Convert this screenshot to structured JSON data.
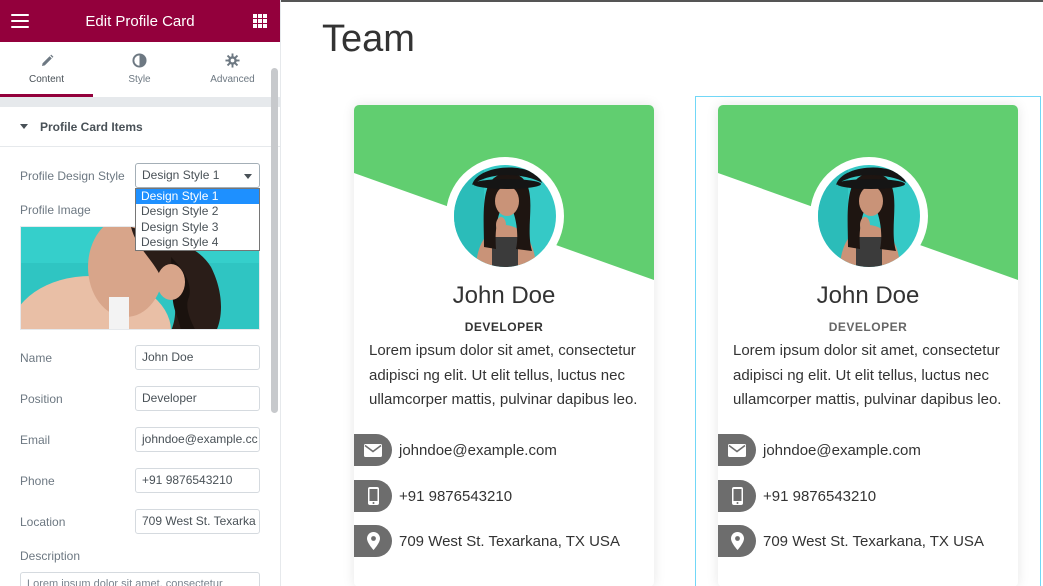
{
  "sidebar": {
    "title": "Edit Profile Card",
    "tabs": [
      {
        "label": "Content",
        "icon": "pencil-icon",
        "active": true
      },
      {
        "label": "Style",
        "icon": "half-circle-icon",
        "active": false
      },
      {
        "label": "Advanced",
        "icon": "gear-icon",
        "active": false
      }
    ],
    "section_title": "Profile Card Items",
    "design_style": {
      "label": "Profile Design Style",
      "value": "Design Style 1",
      "options": [
        "Design Style 1",
        "Design Style 2",
        "Design Style 3",
        "Design Style 4"
      ]
    },
    "profile_image_label": "Profile Image",
    "fields": {
      "name": {
        "label": "Name",
        "value": "John Doe"
      },
      "position": {
        "label": "Position",
        "value": "Developer"
      },
      "email": {
        "label": "Email",
        "value": "johndoe@example.cc"
      },
      "phone": {
        "label": "Phone",
        "value": "+91 9876543210"
      },
      "location": {
        "label": "Location",
        "value": "709 West St. Texarka"
      },
      "description": {
        "label": "Description",
        "value": "Lorem ipsum dolor sit amet, consectetur"
      }
    }
  },
  "page": {
    "title": "Team"
  },
  "cards": [
    {
      "name": "John Doe",
      "position": "DEVELOPER",
      "description": "Lorem ipsum dolor sit amet, consectetur adipisci ng elit. Ut elit tellus, luctus nec ullamcorper mattis, pulvinar dapibus leo.",
      "email": "johndoe@example.com",
      "phone": "+91 9876543210",
      "location": "709 West St. Texarkana, TX USA"
    },
    {
      "name": "John Doe",
      "position": "DEVELOPER",
      "description": "Lorem ipsum dolor sit amet, consectetur adipisci ng elit. Ut elit tellus, luctus nec ullamcorper mattis, pulvinar dapibus leo.",
      "email": "johndoe@example.com",
      "phone": "+91 9876543210",
      "location": "709 West St. Texarkana, TX USA"
    }
  ],
  "colors": {
    "brand": "#93003c",
    "card_accent": "#61ce70",
    "icon_badge": "#6d6d6d",
    "selection_outline": "#71d7f7"
  }
}
